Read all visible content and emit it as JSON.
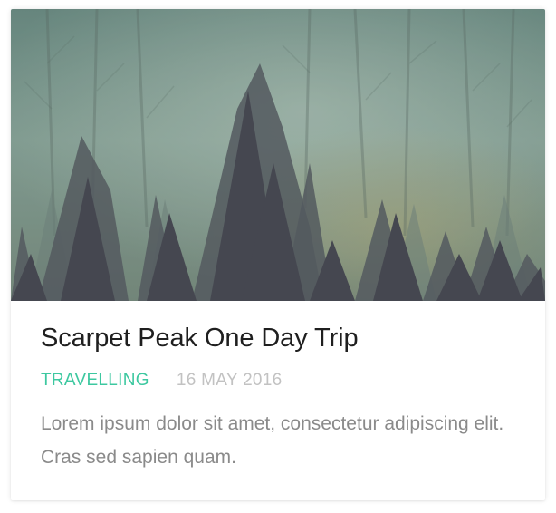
{
  "card": {
    "image": {
      "description": "forest-image",
      "palette": {
        "sky": "#6f8e84",
        "mist": "#8aa59a",
        "trees_dark": "#3b3a45",
        "trees_mid": "#5a6660",
        "autumn": "#9c9a6e"
      }
    },
    "title": "Scarpet Peak One Day Trip",
    "category": "TRAVELLING",
    "date": "16 MAY 2016",
    "excerpt": "Lorem ipsum dolor sit amet, consectetur adipiscing elit. Cras sed sapien quam.",
    "colors": {
      "category": "#3dc8a0",
      "date": "#c2c2c2",
      "title": "#1f1f1f",
      "excerpt": "#8a8a8a"
    }
  }
}
